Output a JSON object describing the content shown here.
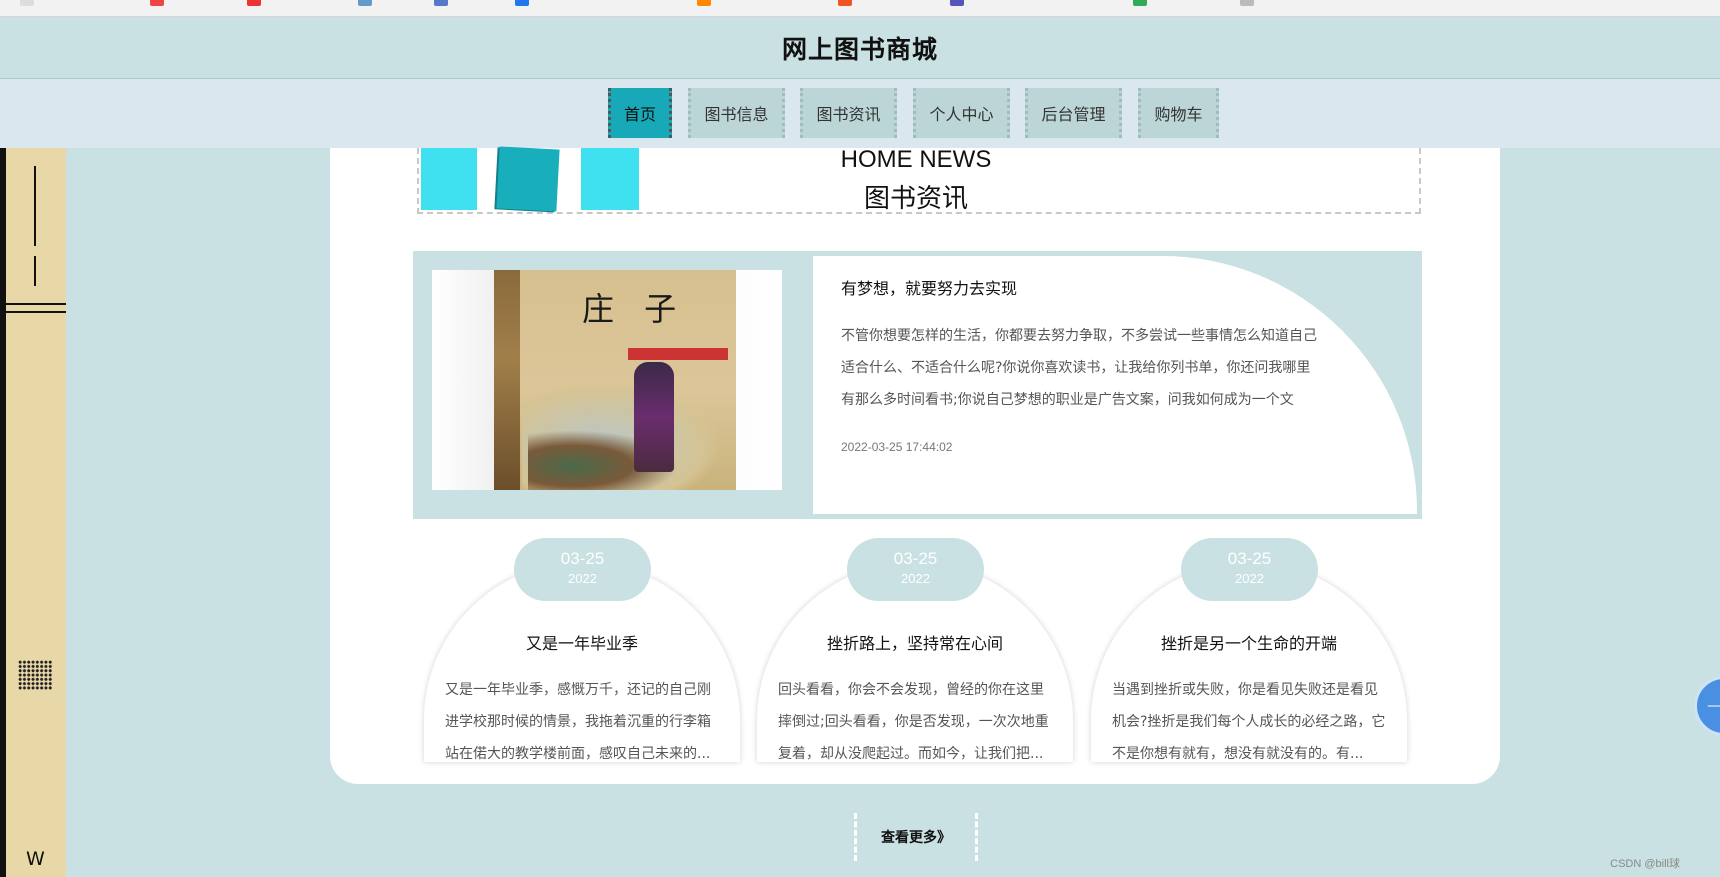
{
  "browser": {
    "bookmarks": [
      "",
      "",
      "",
      "",
      "",
      "",
      "",
      ""
    ]
  },
  "site": {
    "title": "网上图书商城"
  },
  "nav": {
    "items": [
      {
        "label": "首页",
        "active": true
      },
      {
        "label": "图书信息",
        "active": false
      },
      {
        "label": "图书资讯",
        "active": false
      },
      {
        "label": "个人中心",
        "active": false
      },
      {
        "label": "后台管理",
        "active": false
      },
      {
        "label": "购物车",
        "active": false
      }
    ]
  },
  "sidebar": {
    "w_label": "W"
  },
  "news": {
    "title_en": "HOME NEWS",
    "title_cn": "图书资讯",
    "featured": {
      "image_icon": "book-cover-image",
      "cover_title": "庄 子",
      "heading": "有梦想，就要努力去实现",
      "body": "不管你想要怎样的生活，你都要去努力争取，不多尝试一些事情怎么知道自己适合什么、不适合什么呢?你说你喜欢读书，让我给你列书单，你还问我哪里有那么多时间看书;你说自己梦想的职业是广告文案，问我如何成为一个文案...",
      "date": "2022-03-25 17:44:02"
    },
    "cards": [
      {
        "month_day": "03-25",
        "year": "2022",
        "title": "又是一年毕业季",
        "body": "又是一年毕业季，感慨万千，还记的自己刚进学校那时候的情景，我拖着沉重的行李箱站在偌大的教学楼前面，感叹自己未来的..."
      },
      {
        "month_day": "03-25",
        "year": "2022",
        "title": "挫折路上，坚持常在心间",
        "body": "回头看看，你会不会发现，曾经的你在这里摔倒过;回头看看，你是否发现，一次次地重复着，却从没爬起过。而如今，让我们把..."
      },
      {
        "month_day": "03-25",
        "year": "2022",
        "title": "挫折是另一个生命的开端",
        "body": "当遇到挫折或失败，你是看见失败还是看见机会?挫折是我们每个人成长的必经之路，它不是你想有就有，想没有就没有的。有..."
      }
    ],
    "more_label": "查看更多》"
  },
  "footer": {
    "watermark": "CSDN @bill球"
  },
  "colors": {
    "accent": "#17a9b8",
    "background": "#c9e1e2",
    "nav_bg": "#dae7ee",
    "sidebar_bg": "#e8d7a7"
  }
}
